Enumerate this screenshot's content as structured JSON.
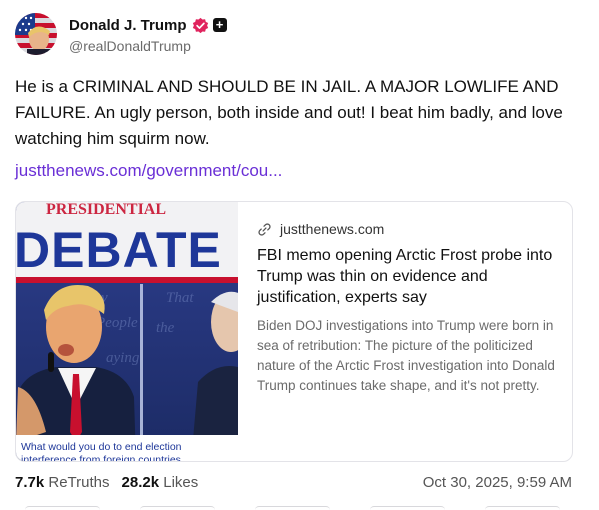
{
  "author": {
    "display_name": "Donald J. Trump",
    "handle": "@realDonaldTrump",
    "avatar_icon": "flag-avatar",
    "verified_icon": "verified-badge-icon",
    "verified_color": "#e0245e"
  },
  "post": {
    "text": "He is a CRIMINAL AND SHOULD BE IN JAIL. A MAJOR LOWLIFE AND FAILURE. An ugly person, both inside and out! I beat him badly, and love watching him squirm now.",
    "link_text": "justthenews.com/government/cou...",
    "link_color": "#6a2fd6"
  },
  "card": {
    "domain": "justthenews.com",
    "title": "FBI memo opening Arctic Frost probe into Trump was thin on evidence and justification, experts say",
    "description": "Biden DOJ investigations into Trump were born in sea of retribution: The picture of the politicized nature of the Arctic Frost investigation into Donald Trump continues take shape, and it's not pretty.",
    "image_banner": "DEBATE",
    "image_banner_top": "PRESIDENTIAL",
    "image_caption_line1": "What would you do to end election",
    "image_caption_line2": "interference from foreign countries"
  },
  "stats": {
    "retruths_count": "7.7k",
    "retruths_label": "ReTruths",
    "likes_count": "28.2k",
    "likes_label": "Likes",
    "timestamp": "Oct 30, 2025, 9:59 AM"
  }
}
